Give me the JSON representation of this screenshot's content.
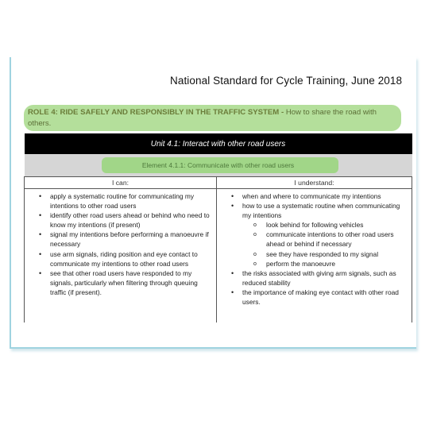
{
  "doc": {
    "title": "National Standard for Cycle Training, June 2018",
    "role_bold": "ROLE 4: RIDE SAFELY AND RESPONSIBLY IN THE TRAFFIC SYSTEM -",
    "role_plain": " How to share the road with others.",
    "unit": "Unit 4.1: Interact with other road users",
    "element": "Element 4.1.1: Communicate with other road users",
    "col_can": "I can:",
    "col_understand": "I understand:"
  },
  "can_items": [
    "apply a systematic routine for communicating my intentions to other road users",
    "identify other road users ahead or behind who need to know my intentions (if present)",
    "signal my intentions before performing a manoeuvre if necessary",
    "use arm signals, riding position and eye contact to communicate my intentions to other road users",
    "see that other road users have responded to my signals, particularly when filtering through queuing traffic (if present)."
  ],
  "understand_items": {
    "item1": "when and where to communicate my intentions",
    "item2": "how to use a systematic routine when communicating my intentions",
    "sub": [
      "look behind for following vehicles",
      "communicate intentions to other road users ahead or behind if necessary",
      "see they have responded to my signal",
      "perform the manoeuvre"
    ],
    "item3": "the risks associated with giving arm signals, such as reduced stability",
    "item4": "the importance of making eye contact with other road users."
  }
}
